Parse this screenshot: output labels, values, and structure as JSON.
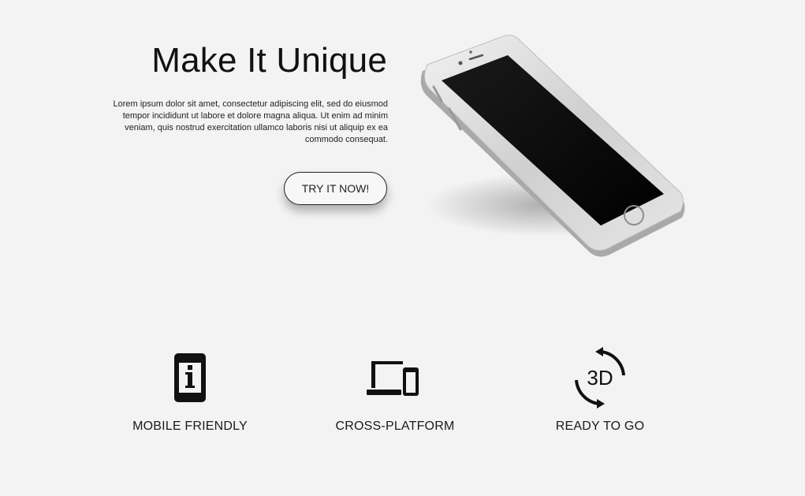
{
  "hero": {
    "title": "Make It Unique",
    "text": "Lorem ipsum dolor sit amet, consectetur adipiscing elit, sed do eiusmod tempor incididunt ut labore et dolore magna aliqua. Ut enim ad minim veniam, quis nostrud exercitation ullamco laboris nisi ut aliquip ex ea commodo consequat.",
    "button_label": "TRY IT NOW!",
    "image": "smartphone-mockup"
  },
  "features": [
    {
      "icon": "mobile-info-icon",
      "label": "MOBILE FRIENDLY"
    },
    {
      "icon": "laptop-phone-icon",
      "label": "CROSS-PLATFORM"
    },
    {
      "icon": "rotate-3d-icon",
      "label": "READY TO GO",
      "icon_text": "3D"
    }
  ],
  "colors": {
    "background": "#f3f3f3",
    "text": "#111111",
    "phone_body": "#d6d6d6",
    "phone_screen": "#000000"
  }
}
